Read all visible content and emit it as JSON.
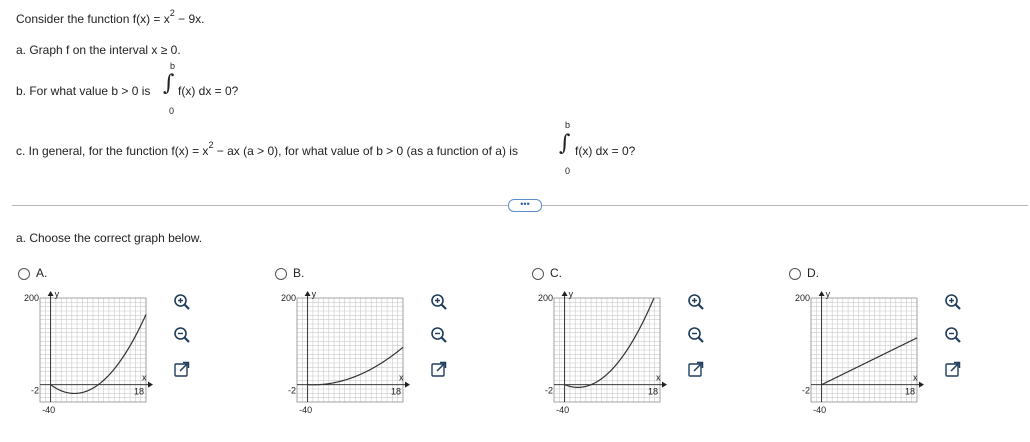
{
  "question": {
    "intro_prefix": "Consider the function f(x) = x",
    "intro_exp": "2",
    "intro_suffix": " − 9x.",
    "part_a": "a. Graph f on the interval x ≥ 0.",
    "part_b_prefix": "b. For what value b > 0 is",
    "part_b_integrand": "f(x) dx = 0?",
    "upper_limit": "b",
    "lower_limit": "0",
    "integral_sign": "∫",
    "part_c_prefix": "c. In general, for the function f(x) = x",
    "part_c_exp": "2",
    "part_c_mid": " − ax (a > 0), for what value of b > 0 (as a function of a) is",
    "part_c_integrand": "f(x) dx = 0?"
  },
  "more_button": "•••",
  "answer_prompt": "a. Choose the correct graph below.",
  "graph_axis": {
    "y_max_label": "200",
    "y_min_label": "-40",
    "x_min_label": "-2",
    "x_max_label": "18",
    "x_axis_letter": "x",
    "y_axis_letter": "y"
  },
  "options": [
    {
      "label": "A."
    },
    {
      "label": "B."
    },
    {
      "label": "C."
    },
    {
      "label": "D."
    }
  ],
  "icons": {
    "zoom_in": "zoom-in-icon",
    "zoom_out": "zoom-out-icon",
    "popout": "popout-icon"
  },
  "colors": {
    "grid": "#c9c9c9",
    "link_blue": "#2a64b3"
  }
}
